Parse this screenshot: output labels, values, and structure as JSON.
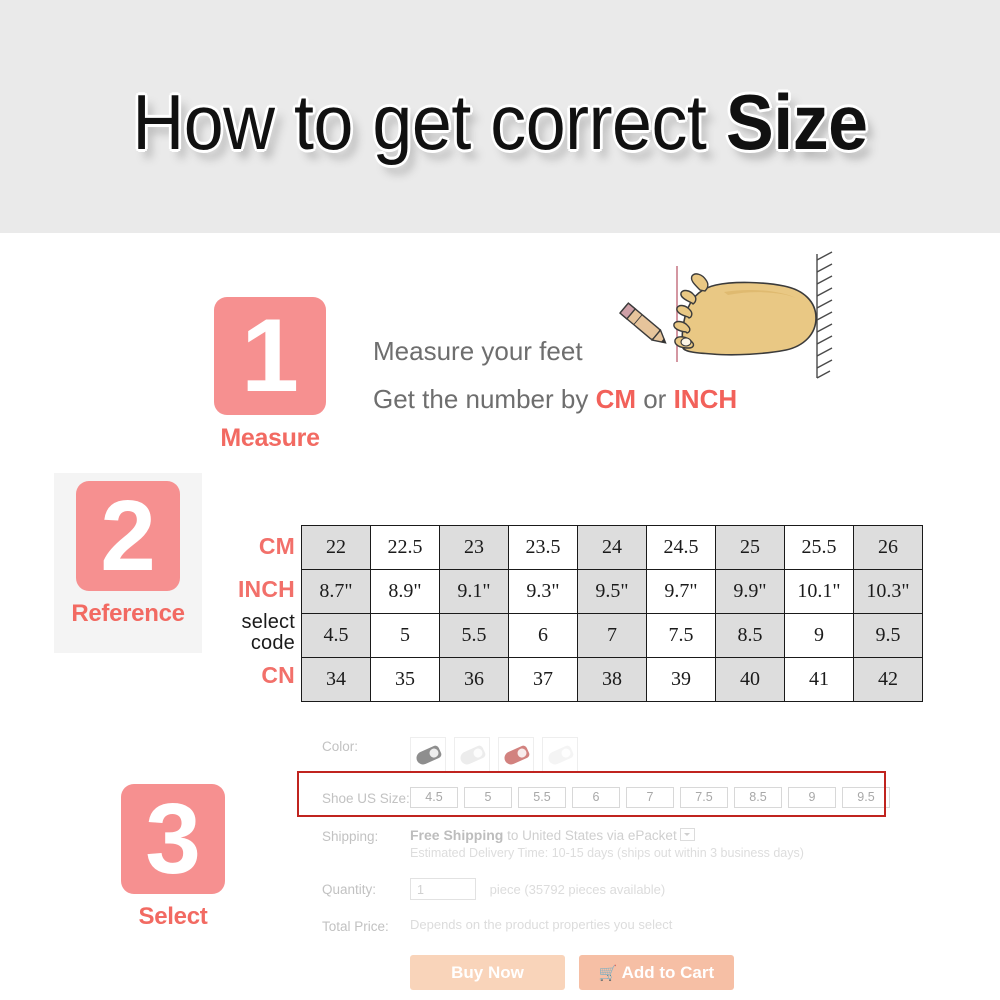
{
  "header": {
    "title_normal": "How to get correct ",
    "title_bold": "Size",
    "background_color": "#eaeaea"
  },
  "theme": {
    "badge_color": "#f69090",
    "accent_color": "#f26a62",
    "highlight_border_color": "#c0241f",
    "table_shade_color": "#dddddd"
  },
  "steps": [
    {
      "number": "1",
      "caption": "Measure"
    },
    {
      "number": "2",
      "caption": "Reference"
    },
    {
      "number": "3",
      "caption": "Select"
    }
  ],
  "step1": {
    "line1": "Measure your feet",
    "line2_prefix": "Get the number by ",
    "line2_hl1": "CM",
    "line2_mid": " or ",
    "line2_hl2": "INCH",
    "illustration": "foot-with-ruler-and-pencil"
  },
  "chart_data": {
    "type": "table",
    "title": "Shoe size reference table",
    "row_labels": [
      "CM",
      "INCH",
      "select code",
      "CN"
    ],
    "rows": [
      {
        "label": "CM",
        "values": [
          "22",
          "22.5",
          "23",
          "23.5",
          "24",
          "24.5",
          "25",
          "25.5",
          "26"
        ]
      },
      {
        "label": "INCH",
        "values": [
          "8.7\"",
          "8.9\"",
          "9.1\"",
          "9.3\"",
          "9.5\"",
          "9.7\"",
          "9.9\"",
          "10.1\"",
          "10.3\""
        ]
      },
      {
        "label": "select code",
        "values": [
          "4.5",
          "5",
          "5.5",
          "6",
          "7",
          "7.5",
          "8.5",
          "9",
          "9.5"
        ]
      },
      {
        "label": "CN",
        "values": [
          "34",
          "35",
          "36",
          "37",
          "38",
          "39",
          "40",
          "41",
          "42"
        ]
      }
    ],
    "columns": 9,
    "shaded_columns": [
      0,
      2,
      4,
      6,
      8
    ]
  },
  "product_panel": {
    "color_label": "Color:",
    "swatches": [
      {
        "name": "swatch-gray",
        "color": "#8e8e8e"
      },
      {
        "name": "swatch-white",
        "color": "#ececec"
      },
      {
        "name": "swatch-red",
        "color": "#d2827f"
      },
      {
        "name": "swatch-ivory",
        "color": "#f4f4f4"
      }
    ],
    "size_label": "Shoe US Size:",
    "sizes": [
      "4.5",
      "5",
      "5.5",
      "6",
      "7",
      "7.5",
      "8.5",
      "9",
      "9.5"
    ],
    "shipping_label": "Shipping:",
    "shipping_free": "Free Shipping",
    "shipping_rest": " to  United States via ePacket",
    "shipping_sub": "Estimated Delivery Time: 10-15 days (ships out within 3 business days)",
    "quantity_label": "Quantity:",
    "quantity_value": "1",
    "quantity_unit": "piece (35792 pieces available)",
    "total_label": "Total Price:",
    "total_value": "Depends on the product properties you select",
    "buy_now_label": "Buy Now",
    "add_to_cart_label": "Add to Cart",
    "cart_icon": "shopping-cart-icon"
  }
}
